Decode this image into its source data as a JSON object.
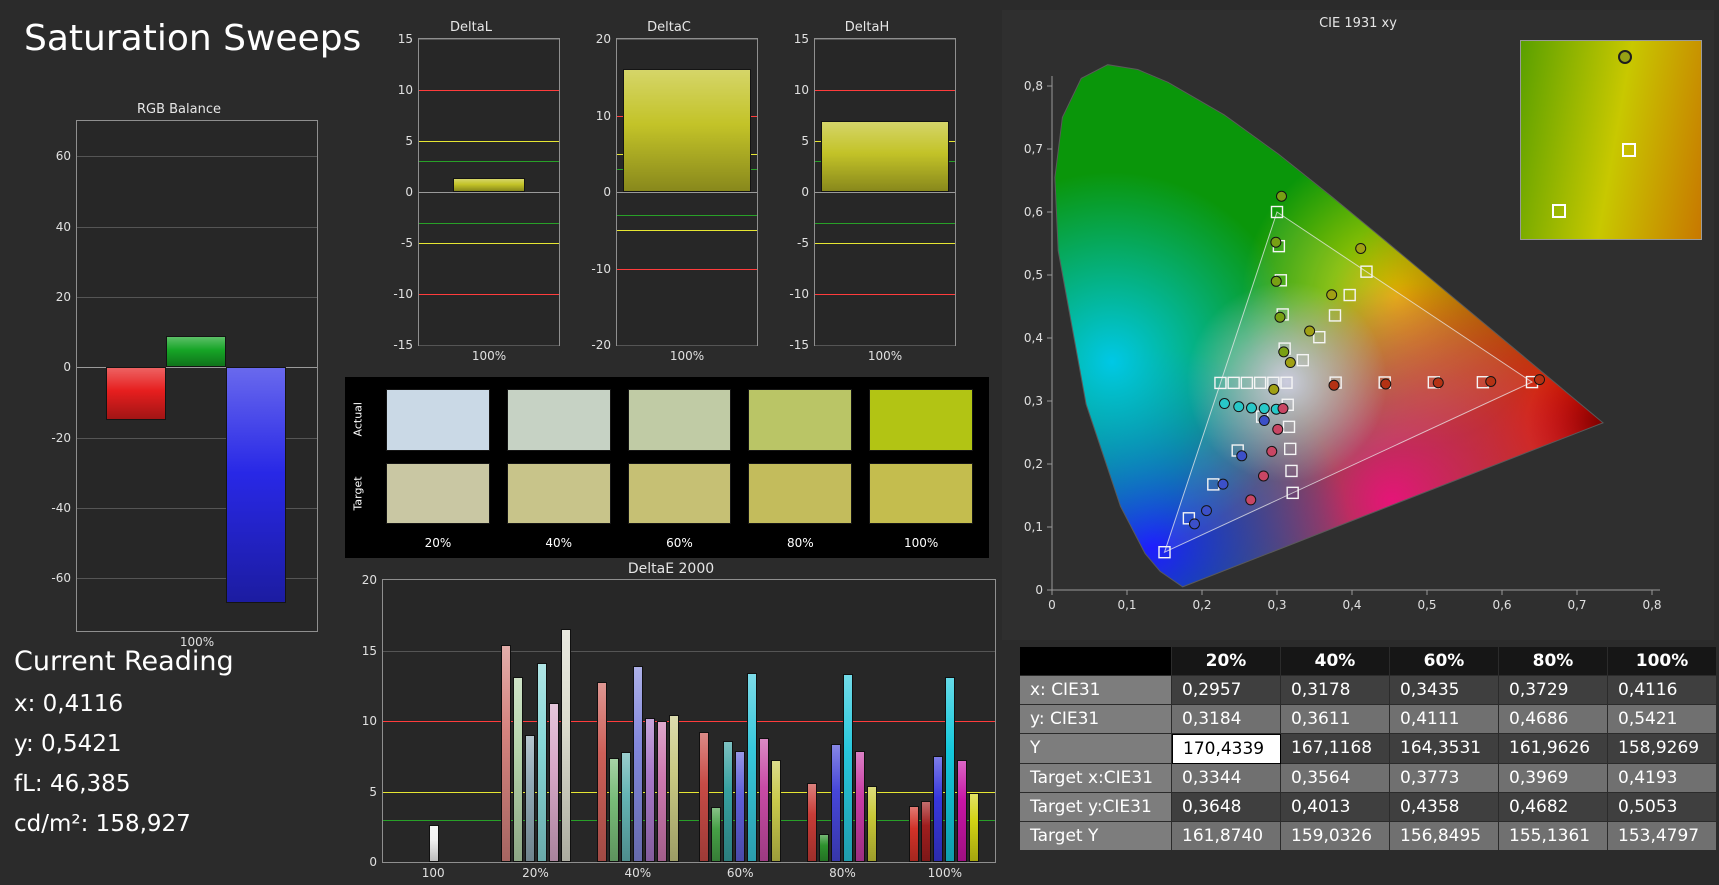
{
  "page_title": "Saturation Sweeps",
  "current_reading": {
    "heading": "Current Reading",
    "lines": [
      "x: 0,4116",
      "y: 0,5421",
      "fL: 46,385",
      "cd/m²: 158,927"
    ]
  },
  "rgb_balance": {
    "title": "RGB Balance",
    "x_label": "100%",
    "ylim": [
      -75,
      70
    ],
    "yticks": [
      60,
      40,
      20,
      0,
      -20,
      -40,
      -60
    ],
    "bars": [
      {
        "name": "red",
        "value": -15,
        "color": "#e61e1e"
      },
      {
        "name": "green",
        "value": 9,
        "color": "#16a526"
      },
      {
        "name": "blue",
        "value": -67,
        "color": "#2828e6"
      }
    ]
  },
  "delta_charts": [
    {
      "title": "DeltaL",
      "x_label": "100%",
      "ylim": [
        -15,
        15
      ],
      "yticks": [
        15,
        10,
        5,
        0,
        -5,
        -10,
        -15
      ],
      "value": 1.4,
      "bar_color": "#c3c328",
      "bar_width_pct": 52,
      "limit_lines": [
        {
          "value": 10,
          "color": "#ff3c3c"
        },
        {
          "value": -10,
          "color": "#ff3c3c"
        },
        {
          "value": 5,
          "color": "#e6e632"
        },
        {
          "value": -5,
          "color": "#e6e632"
        },
        {
          "value": 3,
          "color": "#28a028"
        },
        {
          "value": -3,
          "color": "#28a028"
        }
      ]
    },
    {
      "title": "DeltaC",
      "x_label": "100%",
      "ylim": [
        -20,
        20
      ],
      "yticks": [
        20,
        10,
        0,
        -10,
        -20
      ],
      "value": 16.1,
      "bar_color": "#c3c328",
      "bar_width_pct": 92,
      "limit_lines": [
        {
          "value": 10,
          "color": "#ff3c3c"
        },
        {
          "value": -10,
          "color": "#ff3c3c"
        },
        {
          "value": 5,
          "color": "#e6e632"
        },
        {
          "value": -5,
          "color": "#e6e632"
        },
        {
          "value": 3,
          "color": "#28a028"
        },
        {
          "value": -3,
          "color": "#28a028"
        }
      ]
    },
    {
      "title": "DeltaH",
      "x_label": "100%",
      "ylim": [
        -15,
        15
      ],
      "yticks": [
        15,
        10,
        5,
        0,
        -5,
        -10,
        -15
      ],
      "value": 7.0,
      "bar_color": "#c3c328",
      "bar_width_pct": 92,
      "limit_lines": [
        {
          "value": 10,
          "color": "#ff3c3c"
        },
        {
          "value": -10,
          "color": "#ff3c3c"
        },
        {
          "value": 5,
          "color": "#e6e632"
        },
        {
          "value": -5,
          "color": "#e6e632"
        },
        {
          "value": 3,
          "color": "#28a028"
        },
        {
          "value": -3,
          "color": "#28a028"
        }
      ]
    }
  ],
  "swatches": {
    "row_labels": [
      "Actual",
      "Target"
    ],
    "col_labels": [
      "20%",
      "40%",
      "60%",
      "80%",
      "100%"
    ],
    "rows": [
      [
        "#cad9e6",
        "#c6d2c4",
        "#c0cba5",
        "#bac566",
        "#b2c414"
      ],
      [
        "#c9c7a3",
        "#c8c48a",
        "#c6c074",
        "#c3bc5c",
        "#c4bd4e"
      ]
    ]
  },
  "deltae": {
    "title": "DeltaE 2000",
    "ylim": [
      0,
      20
    ],
    "yticks": [
      0,
      5,
      10,
      15,
      20
    ],
    "gridlines": [
      15
    ],
    "limit_lines": [
      {
        "value": 10,
        "color": "#ff3c3c"
      },
      {
        "value": 5,
        "color": "#e6e632"
      },
      {
        "value": 3,
        "color": "#28a028"
      }
    ],
    "groups": [
      {
        "label": "100",
        "bars": [
          {
            "color": "#f0f0f0",
            "value": 2.6
          }
        ]
      },
      {
        "label": "20%",
        "bars": [
          {
            "color": "#d4827d",
            "value": 15.4
          },
          {
            "color": "#b4d4aa",
            "value": 13.1
          },
          {
            "color": "#8fa8b4",
            "value": 9.0
          },
          {
            "color": "#87d8d8",
            "value": 14.1
          },
          {
            "color": "#d8a8c8",
            "value": 11.3
          },
          {
            "color": "#dcdccd",
            "value": 16.5
          }
        ]
      },
      {
        "label": "40%",
        "bars": [
          {
            "color": "#cd5f58",
            "value": 12.8
          },
          {
            "color": "#78bc78",
            "value": 7.4
          },
          {
            "color": "#64b4b4",
            "value": 7.8
          },
          {
            "color": "#8287dc",
            "value": 13.9
          },
          {
            "color": "#a878c8",
            "value": 10.2
          },
          {
            "color": "#cd78b0",
            "value": 10.0
          },
          {
            "color": "#c8c882",
            "value": 10.4
          }
        ]
      },
      {
        "label": "60%",
        "bars": [
          {
            "color": "#c84b46",
            "value": 9.2
          },
          {
            "color": "#46a046",
            "value": 3.9
          },
          {
            "color": "#37a0a0",
            "value": 8.6
          },
          {
            "color": "#5f5fd8",
            "value": 7.9
          },
          {
            "color": "#37c8dc",
            "value": 13.4
          },
          {
            "color": "#c84ba5",
            "value": 8.8
          },
          {
            "color": "#c8c84b",
            "value": 7.2
          }
        ]
      },
      {
        "label": "80%",
        "bars": [
          {
            "color": "#c83c37",
            "value": 5.6
          },
          {
            "color": "#2d912d",
            "value": 2.0
          },
          {
            "color": "#4646d8",
            "value": 8.4
          },
          {
            "color": "#28c8dc",
            "value": 13.3
          },
          {
            "color": "#c83ca5",
            "value": 7.9
          },
          {
            "color": "#c8c837",
            "value": 5.4
          }
        ]
      },
      {
        "label": "100%",
        "bars": [
          {
            "color": "#d23228",
            "value": 4.0
          },
          {
            "color": "#a01e1e",
            "value": 4.3
          },
          {
            "color": "#3737dc",
            "value": 7.5
          },
          {
            "color": "#14c8dc",
            "value": 13.1
          },
          {
            "color": "#c814a5",
            "value": 7.2
          },
          {
            "color": "#d2d214",
            "value": 4.9
          }
        ]
      }
    ]
  },
  "cie": {
    "title": "CIE 1931 xy",
    "axis_ticks": [
      "0",
      "0,1",
      "0,2",
      "0,3",
      "0,4",
      "0,5",
      "0,6",
      "0,7",
      "0,8"
    ],
    "gamut_triangle": [
      [
        0.64,
        0.33
      ],
      [
        0.3,
        0.6
      ],
      [
        0.15,
        0.06
      ]
    ],
    "target_squares": [
      [
        0.3127,
        0.329
      ],
      [
        0.3782,
        0.3292
      ],
      [
        0.4436,
        0.3294
      ],
      [
        0.5091,
        0.3296
      ],
      [
        0.5745,
        0.3298
      ],
      [
        0.64,
        0.33
      ],
      [
        0.3102,
        0.3832
      ],
      [
        0.3076,
        0.4374
      ],
      [
        0.3051,
        0.4916
      ],
      [
        0.3025,
        0.5458
      ],
      [
        0.3,
        0.6
      ],
      [
        0.2802,
        0.2752
      ],
      [
        0.2476,
        0.2214
      ],
      [
        0.2151,
        0.1676
      ],
      [
        0.1825,
        0.1138
      ],
      [
        0.15,
        0.06
      ],
      [
        0.2951,
        0.3289
      ],
      [
        0.2775,
        0.3289
      ],
      [
        0.2598,
        0.3288
      ],
      [
        0.2422,
        0.3288
      ],
      [
        0.2246,
        0.3287
      ],
      [
        0.3143,
        0.294
      ],
      [
        0.316,
        0.259
      ],
      [
        0.3176,
        0.224
      ],
      [
        0.3193,
        0.189
      ],
      [
        0.3209,
        0.1542
      ],
      [
        0.3344,
        0.3648
      ],
      [
        0.3564,
        0.4013
      ],
      [
        0.3773,
        0.4358
      ],
      [
        0.3969,
        0.4682
      ],
      [
        0.4193,
        0.5053
      ]
    ],
    "measurements": [
      {
        "name": "yellow",
        "color": "#a0a014",
        "points": [
          [
            0.2957,
            0.3184
          ],
          [
            0.3178,
            0.3611
          ],
          [
            0.3435,
            0.4111
          ],
          [
            0.3729,
            0.4686
          ],
          [
            0.4116,
            0.5421
          ]
        ]
      },
      {
        "name": "green",
        "color": "#78a014",
        "points": [
          [
            0.309,
            0.378
          ],
          [
            0.304,
            0.433
          ],
          [
            0.299,
            0.49
          ],
          [
            0.2985,
            0.552
          ],
          [
            0.306,
            0.625
          ]
        ]
      },
      {
        "name": "red",
        "color": "#b43214",
        "points": [
          [
            0.376,
            0.325
          ],
          [
            0.445,
            0.327
          ],
          [
            0.515,
            0.329
          ],
          [
            0.585,
            0.331
          ],
          [
            0.65,
            0.334
          ]
        ]
      },
      {
        "name": "blue",
        "color": "#3c50c8",
        "points": [
          [
            0.283,
            0.269
          ],
          [
            0.253,
            0.213
          ],
          [
            0.228,
            0.168
          ],
          [
            0.206,
            0.126
          ],
          [
            0.19,
            0.105
          ]
        ]
      },
      {
        "name": "cyan",
        "color": "#28c8c8",
        "points": [
          [
            0.299,
            0.287
          ],
          [
            0.283,
            0.288
          ],
          [
            0.266,
            0.289
          ],
          [
            0.249,
            0.291
          ],
          [
            0.23,
            0.296
          ]
        ]
      },
      {
        "name": "magenta",
        "color": "#c84664",
        "points": [
          [
            0.308,
            0.288
          ],
          [
            0.301,
            0.255
          ],
          [
            0.293,
            0.22
          ],
          [
            0.282,
            0.181
          ],
          [
            0.265,
            0.143
          ]
        ]
      }
    ],
    "inset": {
      "circle_color": "#96a014",
      "markers": [
        {
          "type": "circle",
          "x": 0.58,
          "y": 0.08
        },
        {
          "type": "square",
          "x": 0.6,
          "y": 0.55
        },
        {
          "type": "square",
          "x": 0.21,
          "y": 0.86
        }
      ]
    }
  },
  "table": {
    "col_headers": [
      "20%",
      "40%",
      "60%",
      "80%",
      "100%"
    ],
    "rows": [
      {
        "label": "x: CIE31",
        "values": [
          "0,2957",
          "0,3178",
          "0,3435",
          "0,3729",
          "0,4116"
        ]
      },
      {
        "label": "y: CIE31",
        "values": [
          "0,3184",
          "0,3611",
          "0,4111",
          "0,4686",
          "0,5421"
        ]
      },
      {
        "label": "Y",
        "values": [
          "170,4339",
          "167,1168",
          "164,3531",
          "161,9626",
          "158,9269"
        ]
      },
      {
        "label": "Target x:CIE31",
        "values": [
          "0,3344",
          "0,3564",
          "0,3773",
          "0,3969",
          "0,4193"
        ]
      },
      {
        "label": "Target y:CIE31",
        "values": [
          "0,3648",
          "0,4013",
          "0,4358",
          "0,4682",
          "0,5053"
        ]
      },
      {
        "label": "Target Y",
        "values": [
          "161,8740",
          "159,0326",
          "156,8495",
          "155,1361",
          "153,4797"
        ]
      }
    ],
    "highlight": {
      "row": 2,
      "col": 0
    }
  }
}
